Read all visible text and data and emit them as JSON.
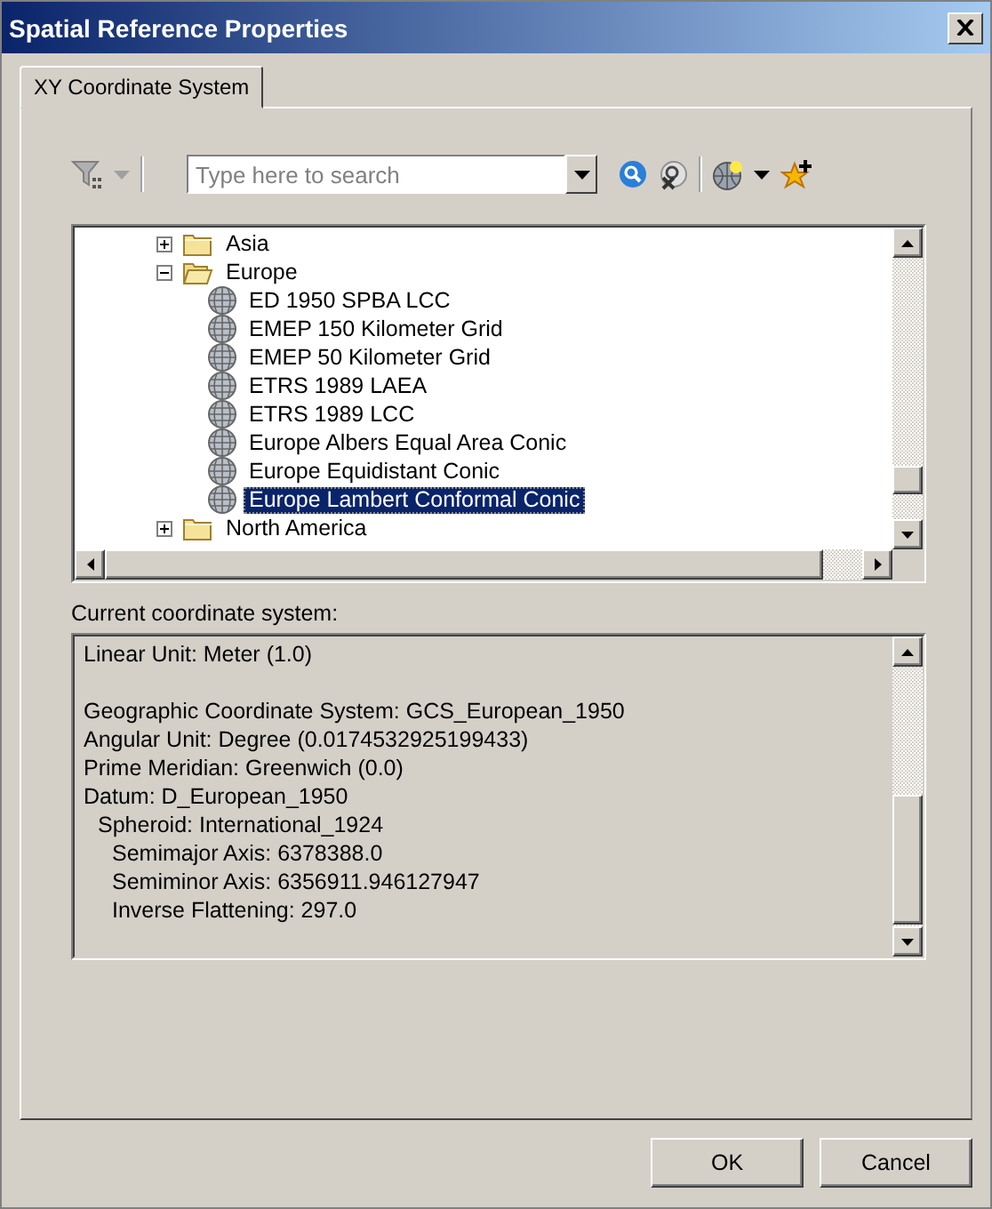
{
  "window": {
    "title": "Spatial Reference Properties"
  },
  "tabs": [
    {
      "label": "XY Coordinate System",
      "selected": true
    }
  ],
  "search": {
    "placeholder": "Type here to search"
  },
  "tree": [
    {
      "label": "Asia",
      "kind": "folder",
      "expanded": false,
      "selected": false
    },
    {
      "label": "Europe",
      "kind": "folder",
      "expanded": true,
      "selected": false,
      "children": [
        {
          "label": "ED 1950 SPBA LCC",
          "kind": "system",
          "selected": false
        },
        {
          "label": "EMEP 150 Kilometer Grid",
          "kind": "system",
          "selected": false
        },
        {
          "label": "EMEP 50 Kilometer Grid",
          "kind": "system",
          "selected": false
        },
        {
          "label": "ETRS 1989 LAEA",
          "kind": "system",
          "selected": false
        },
        {
          "label": "ETRS 1989 LCC",
          "kind": "system",
          "selected": false
        },
        {
          "label": "Europe Albers Equal Area Conic",
          "kind": "system",
          "selected": false
        },
        {
          "label": "Europe Equidistant Conic",
          "kind": "system",
          "selected": false
        },
        {
          "label": "Europe Lambert Conformal Conic",
          "kind": "system",
          "selected": true
        }
      ]
    },
    {
      "label": "North America",
      "kind": "folder",
      "expanded": false,
      "selected": false
    }
  ],
  "current_label": "Current coordinate system:",
  "details": {
    "sections": [
      {
        "lines": [
          {
            "text": "Linear Unit: Meter (1.0)"
          }
        ]
      },
      {
        "lines": [
          {
            "text": "Geographic Coordinate System: GCS_European_1950"
          },
          {
            "text": "Angular Unit: Degree (0.0174532925199433)"
          },
          {
            "text": "Prime Meridian: Greenwich (0.0)"
          },
          {
            "text": "Datum: D_European_1950",
            "children": [
              {
                "text": "Spheroid: International_1924",
                "children": [
                  {
                    "text": "Semimajor Axis: 6378388.0"
                  },
                  {
                    "text": "Semiminor Axis: 6356911.946127947"
                  },
                  {
                    "text": "Inverse Flattening: 297.0"
                  }
                ]
              }
            ]
          }
        ]
      }
    ]
  },
  "buttons": [
    {
      "label": "OK"
    },
    {
      "label": "Cancel"
    }
  ]
}
